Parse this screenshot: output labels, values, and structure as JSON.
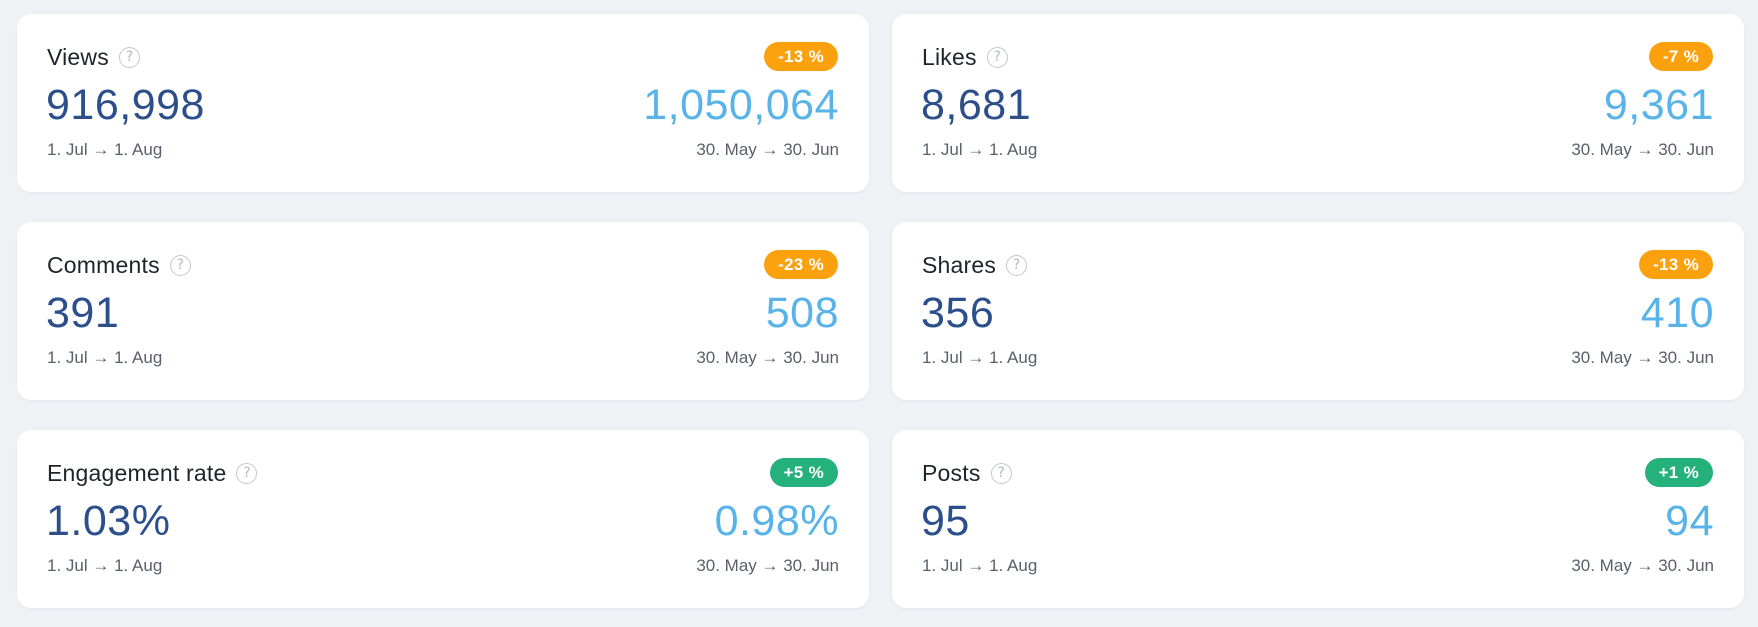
{
  "colors": {
    "current_value": "#2c4f8c",
    "previous_value": "#58b3e9",
    "badge_negative": "#fba10d",
    "badge_positive": "#25b17b",
    "background": "#eff1f5"
  },
  "help_icon": {
    "glyph": "?",
    "icon": "question-circle-icon"
  },
  "cards": [
    {
      "key": "views",
      "title": "Views",
      "change": "-13 %",
      "trend": "negative",
      "current_value": "916,998",
      "current_period": "1. Jul → 1. Aug",
      "previous_value": "1,050,064",
      "previous_period": "30. May → 30. Jun"
    },
    {
      "key": "likes",
      "title": "Likes",
      "change": "-7 %",
      "trend": "negative",
      "current_value": "8,681",
      "current_period": "1. Jul → 1. Aug",
      "previous_value": "9,361",
      "previous_period": "30. May → 30. Jun"
    },
    {
      "key": "comments",
      "title": "Comments",
      "change": "-23 %",
      "trend": "negative",
      "current_value": "391",
      "current_period": "1. Jul → 1. Aug",
      "previous_value": "508",
      "previous_period": "30. May → 30. Jun"
    },
    {
      "key": "shares",
      "title": "Shares",
      "change": "-13 %",
      "trend": "negative",
      "current_value": "356",
      "current_period": "1. Jul → 1. Aug",
      "previous_value": "410",
      "previous_period": "30. May → 30. Jun"
    },
    {
      "key": "engagement-rate",
      "title": "Engagement rate",
      "change": "+5 %",
      "trend": "positive",
      "current_value": "1.03%",
      "current_period": "1. Jul → 1. Aug",
      "previous_value": "0.98%",
      "previous_period": "30. May → 30. Jun"
    },
    {
      "key": "posts",
      "title": "Posts",
      "change": "+1 %",
      "trend": "positive",
      "current_value": "95",
      "current_period": "1. Jul → 1. Aug",
      "previous_value": "94",
      "previous_period": "30. May → 30. Jun"
    }
  ]
}
